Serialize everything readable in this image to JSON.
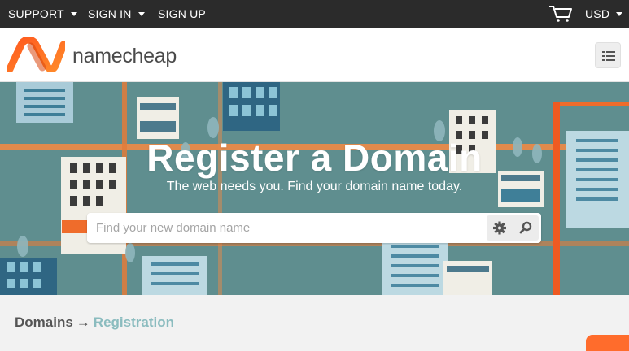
{
  "topbar": {
    "support": "SUPPORT",
    "sign_in": "SIGN IN",
    "sign_up": "SIGN UP",
    "currency": "USD"
  },
  "header": {
    "logo_text": "namecheap"
  },
  "hero": {
    "title": "Register a Domain",
    "subtitle": "The web needs you. Find your domain name today.",
    "search_placeholder": "Find your new domain name"
  },
  "breadcrumb": {
    "parent": "Domains",
    "separator": "→",
    "current": "Registration"
  },
  "colors": {
    "brand_orange": "#ff6c2c",
    "hero_teal": "#5f8e8f",
    "topbar": "#2b2b2b",
    "breadcrumb_current": "#8bbcbf"
  }
}
